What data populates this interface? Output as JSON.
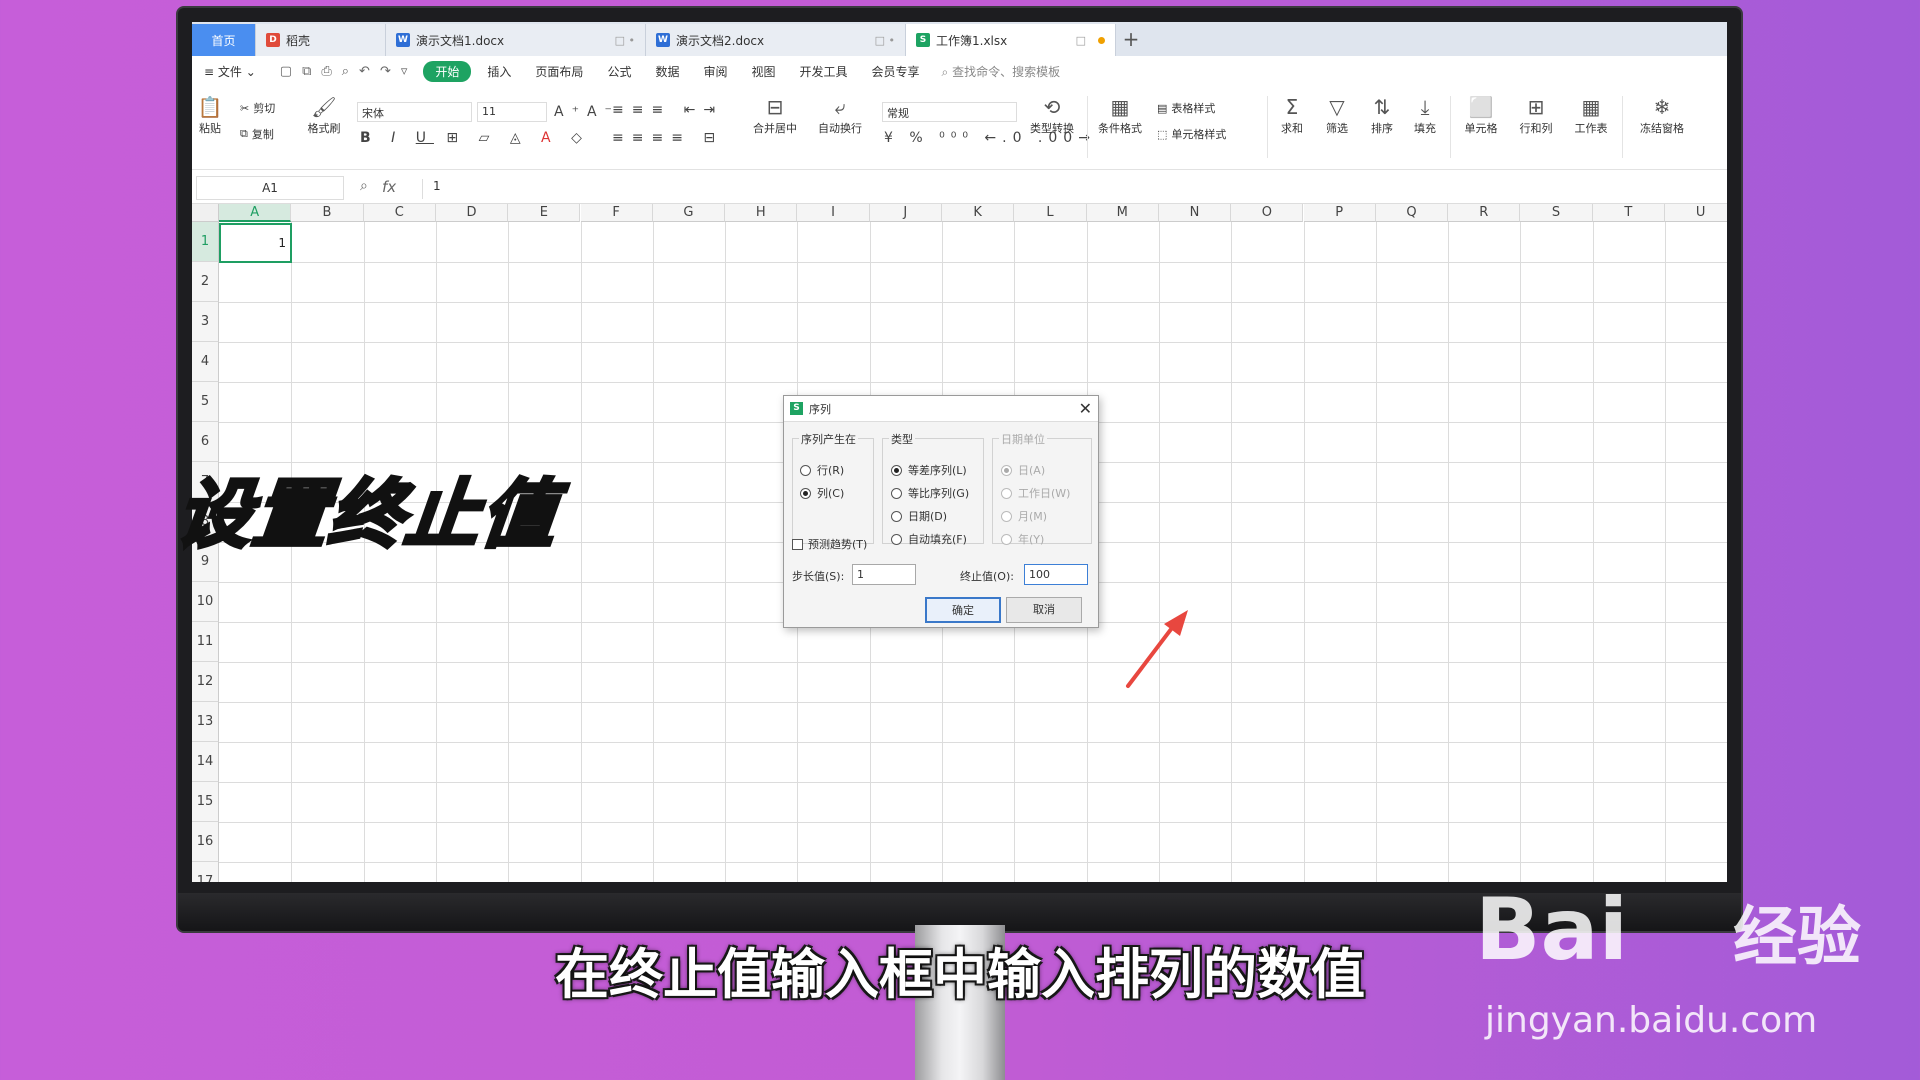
{
  "tabs": [
    {
      "label": "首页",
      "type": "home"
    },
    {
      "label": "稻壳",
      "type": "shell"
    },
    {
      "label": "演示文档1.docx",
      "type": "normal"
    },
    {
      "label": "演示文档2.docx",
      "type": "normal"
    },
    {
      "label": "工作簿1.xlsx",
      "type": "active"
    }
  ],
  "menu": {
    "file": "文件",
    "items": [
      "开始",
      "插入",
      "页面布局",
      "公式",
      "数据",
      "审阅",
      "视图",
      "开发工具",
      "会员专享"
    ],
    "search": "查找命令、搜索模板"
  },
  "ribbon": {
    "paste": "粘贴",
    "cut": "剪切",
    "copy": "复制",
    "format_painter": "格式刷",
    "font": "宋体",
    "size": "11",
    "merge": "合并居中",
    "wrap": "自动换行",
    "number_format": "常规",
    "convert": "类型转换",
    "cond_format": "条件格式",
    "table_style": "表格样式",
    "cell_style": "单元格样式",
    "sum": "求和",
    "filter": "筛选",
    "sort": "排序",
    "fill": "填充",
    "cell": "单元格",
    "rowcol": "行和列",
    "sheet": "工作表",
    "freeze": "冻结窗格"
  },
  "formula_bar": {
    "name_box": "A1",
    "fx": "fx",
    "value": "1"
  },
  "columns": [
    "A",
    "B",
    "C",
    "D",
    "E",
    "F",
    "G",
    "H",
    "I",
    "J",
    "K",
    "L",
    "M",
    "N",
    "O",
    "P",
    "Q",
    "R",
    "S",
    "T",
    "U"
  ],
  "rows": [
    "1",
    "2",
    "3",
    "4",
    "5",
    "6",
    "7",
    "8",
    "9",
    "10",
    "11",
    "12",
    "13",
    "14",
    "15",
    "16",
    "17"
  ],
  "cell_a1": "1",
  "dialog": {
    "title": "序列",
    "group_series_in": "序列产生在",
    "row": "行(R)",
    "col": "列(C)",
    "group_type": "类型",
    "linear": "等差序列(L)",
    "growth": "等比序列(G)",
    "date": "日期(D)",
    "autofill": "自动填充(F)",
    "group_date_unit": "日期单位",
    "day": "日(A)",
    "weekday": "工作日(W)",
    "month": "月(M)",
    "year": "年(Y)",
    "trend": "预测趋势(T)",
    "step_label": "步长值(S):",
    "step_value": "1",
    "stop_label": "终止值(O):",
    "stop_value": "100",
    "ok": "确定",
    "cancel": "取消"
  },
  "overlay": {
    "big_caption": "设置终止值",
    "subtitle": "在终止值输入框中输入排列的数值",
    "watermark_brand_a": "Bai",
    "watermark_brand_b": "经验",
    "watermark_url": "jingyan.baidu.com"
  },
  "colors": {
    "accent": "#1ea362",
    "home_tab": "#4a8ef0",
    "arrow": "#e8473f"
  }
}
